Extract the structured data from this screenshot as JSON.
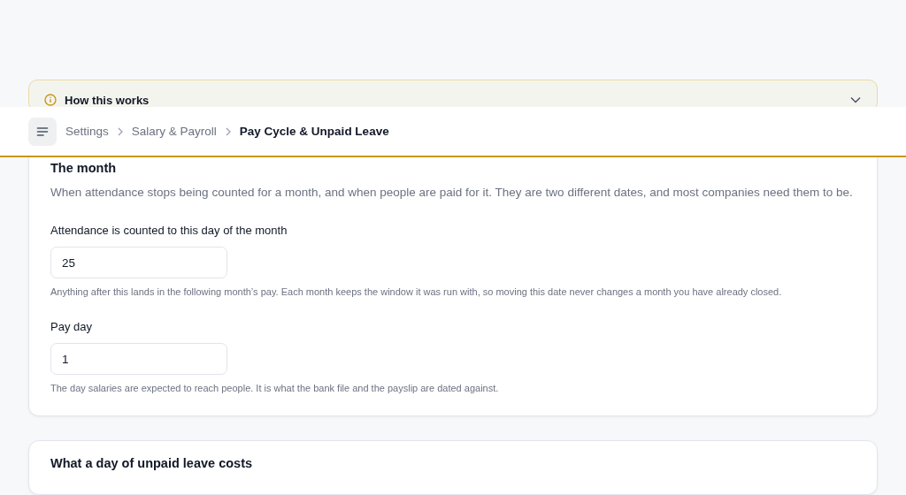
{
  "notice": {
    "title": "How this works",
    "expanded": false
  },
  "breadcrumbs": [
    {
      "label": "Settings",
      "current": false
    },
    {
      "label": "Salary & Payroll",
      "current": false
    },
    {
      "label": "Pay Cycle & Unpaid Leave",
      "current": true
    }
  ],
  "cards": [
    {
      "title": "The month",
      "description": "When attendance stops being counted for a month, and when people are paid for it. They are two different dates, and most companies need them to be.",
      "fields": [
        {
          "label": "Attendance is counted to this day of the month",
          "value": "25",
          "help": "Anything after this lands in the following month’s pay. Each month keeps the window it was run with, so moving this date never changes a month you have already closed."
        },
        {
          "label": "Pay day",
          "value": "1",
          "help": "The day salaries are expected to reach people. It is what the bank file and the payslip are dated against."
        }
      ]
    },
    {
      "title": "What a day of unpaid leave costs"
    }
  ]
}
